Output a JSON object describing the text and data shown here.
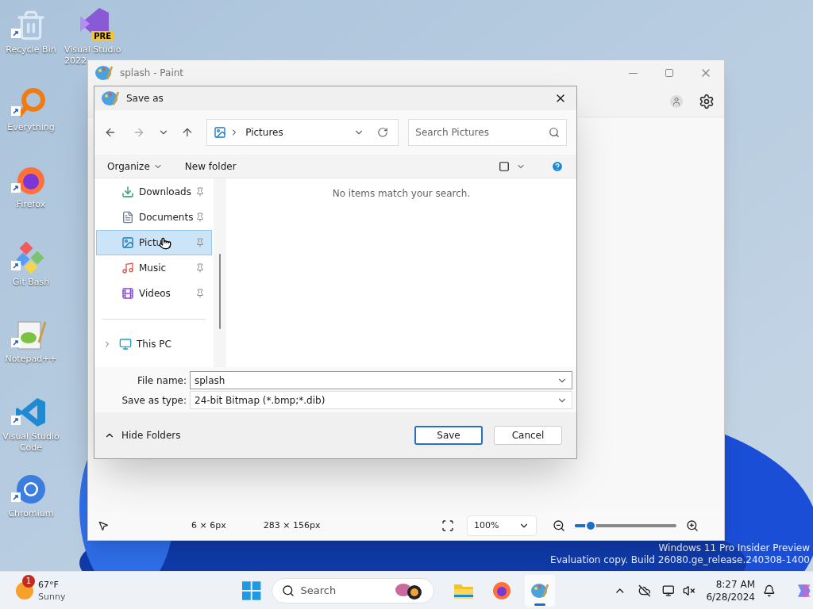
{
  "desktop": {
    "icons": [
      {
        "label": "Recycle Bin",
        "kind": "recycle"
      },
      {
        "label": "Everything",
        "kind": "everything"
      },
      {
        "label": "Firefox",
        "kind": "firefox"
      },
      {
        "label": "Git Bash",
        "kind": "gitbash"
      },
      {
        "label": "Notepad++",
        "kind": "notepad"
      },
      {
        "label": "Visual Studio Code",
        "kind": "vscode"
      },
      {
        "label": "Chromium",
        "kind": "chromium"
      }
    ],
    "second_column_icon": {
      "label": "Visual Studio 2022",
      "badge": "PRE"
    },
    "watermark": [
      "Windows 11 Pro Insider Preview",
      "Evaluation copy. Build 26080.ge_release.240308-1400"
    ]
  },
  "paint_window": {
    "title": "splash - Paint",
    "status_bar": {
      "selection_size": "6 × 6px",
      "canvas_size": "283 × 156px",
      "zoom": "100%",
      "zoom_slider": {
        "level": 0.16
      }
    }
  },
  "save_dialog": {
    "title": "Save as",
    "address": "Pictures",
    "search_placeholder": "Search Pictures",
    "toolbar": {
      "organize": "Organize",
      "new_folder": "New folder"
    },
    "nav_items": [
      {
        "label": "Downloads",
        "kind": "downloads",
        "selected": false
      },
      {
        "label": "Documents",
        "kind": "documents",
        "selected": false
      },
      {
        "label": "Pictu",
        "kind": "pictures",
        "selected": true
      },
      {
        "label": "Music",
        "kind": "music",
        "selected": false
      },
      {
        "label": "Videos",
        "kind": "videos",
        "selected": false
      }
    ],
    "this_pc": {
      "label": "This PC",
      "expanded": false
    },
    "empty_message": "No items match your search.",
    "file_name_label": "File name:",
    "file_name": "splash",
    "type_label": "Save as type:",
    "type_value": "24-bit Bitmap (*.bmp;*.dib)",
    "hide_folders": "Hide Folders",
    "buttons": [
      {
        "label": "Save",
        "default": true
      },
      {
        "label": "Cancel",
        "default": false
      }
    ]
  },
  "taskbar": {
    "weather": {
      "badge": "1",
      "temperature": "67°F",
      "condition": "Sunny"
    },
    "search_placeholder": "Search",
    "apps": [
      {
        "kind": "explorer",
        "active": false
      },
      {
        "kind": "firefox",
        "active": false
      },
      {
        "kind": "paint",
        "active": true
      }
    ],
    "clock": {
      "time": "8:27 AM",
      "date": "6/28/2024"
    }
  }
}
